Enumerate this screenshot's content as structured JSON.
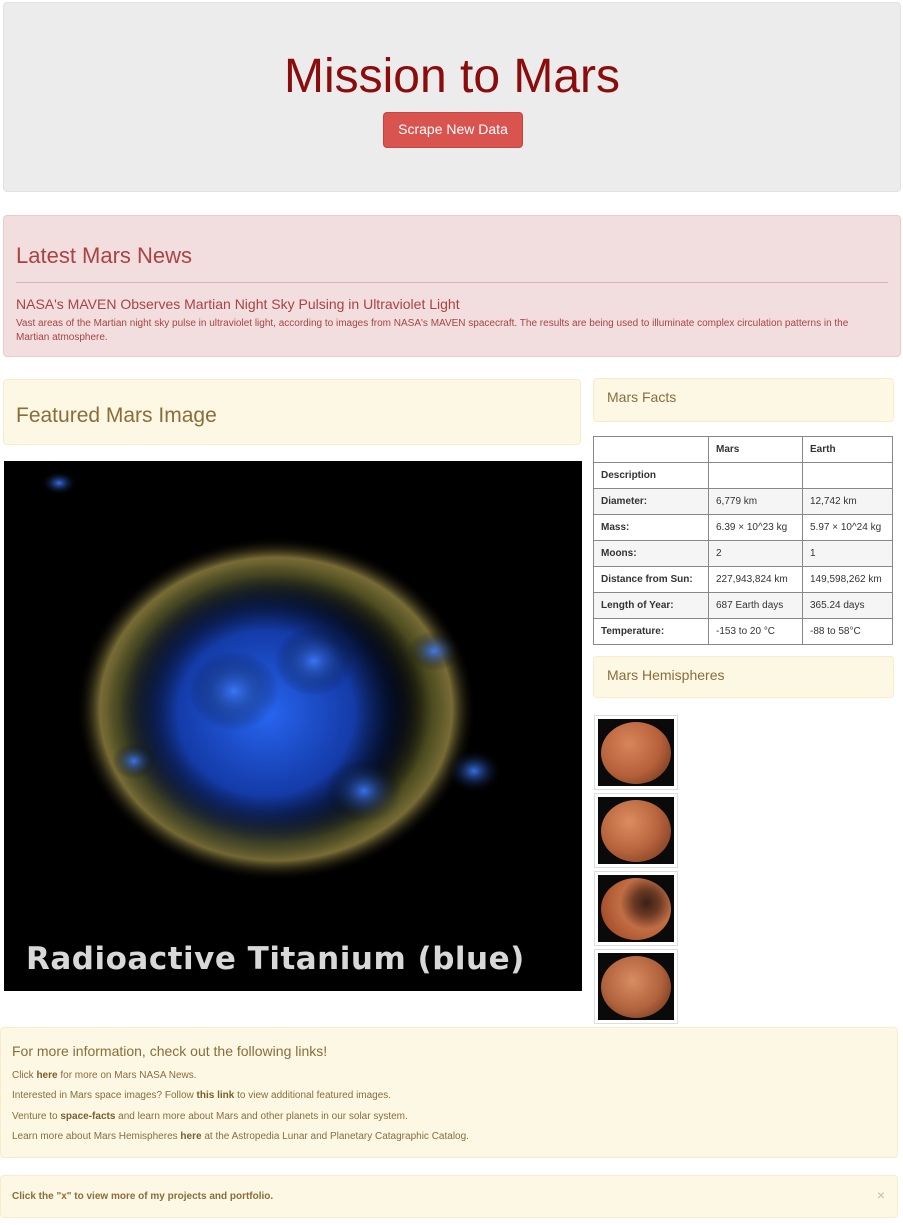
{
  "header": {
    "title": "Mission to Mars",
    "scrape_button": "Scrape New Data"
  },
  "news": {
    "heading": "Latest Mars News",
    "title": "NASA's MAVEN Observes Martian Night Sky Pulsing in Ultraviolet Light",
    "body": "Vast areas of the Martian night sky pulse in ultraviolet light, according to images from NASA's MAVEN spacecraft. The results are being used to illuminate complex circulation patterns in the Martian atmosphere."
  },
  "featured": {
    "heading": "Featured Mars Image",
    "caption": "Radioactive Titanium (blue)"
  },
  "facts": {
    "heading": "Mars Facts",
    "columns": [
      "",
      "Mars",
      "Earth"
    ],
    "rows": [
      [
        "Description",
        "",
        ""
      ],
      [
        "Diameter:",
        "6,779 km",
        "12,742 km"
      ],
      [
        "Mass:",
        "6.39 × 10^23 kg",
        "5.97 × 10^24 kg"
      ],
      [
        "Moons:",
        "2",
        "1"
      ],
      [
        "Distance from Sun:",
        "227,943,824 km",
        "149,598,262 km"
      ],
      [
        "Length of Year:",
        "687 Earth days",
        "365.24 days"
      ],
      [
        "Temperature:",
        "-153 to 20 °C",
        "-88 to 58°C"
      ]
    ]
  },
  "hemispheres": {
    "heading": "Mars Hemispheres",
    "thumbs": [
      {
        "name": "hemisphere-1",
        "color": "#b5603a"
      },
      {
        "name": "hemisphere-2",
        "color": "#b8653e"
      },
      {
        "name": "hemisphere-3",
        "color": "#a9532f"
      },
      {
        "name": "hemisphere-4",
        "color": "#b0623c"
      }
    ]
  },
  "links": {
    "heading": "For more information, check out the following links!",
    "line1_pre": "Click ",
    "line1_link": "here",
    "line1_post": " for more on Mars NASA News.",
    "line2_pre": "Interested in Mars space images? Follow ",
    "line2_link": "this link",
    "line2_post": " to view additional featured images.",
    "line3_pre": "Venture to ",
    "line3_link": "space-facts",
    "line3_post": " and learn more about Mars and other planets in our solar system.",
    "line4_pre": "Learn more about Mars Hemispheres ",
    "line4_link": "here",
    "line4_post": " at the Astropedia Lunar and Planetary Catagraphic Catalog."
  },
  "alert": {
    "message": "Click the \"x\" to view more of my projects and portfolio.",
    "close": "×"
  },
  "colors": {
    "title": "#8b0c0c",
    "button": "#d9534f",
    "news_bg": "#f2dede",
    "warn_bg": "#fcf8e3"
  }
}
